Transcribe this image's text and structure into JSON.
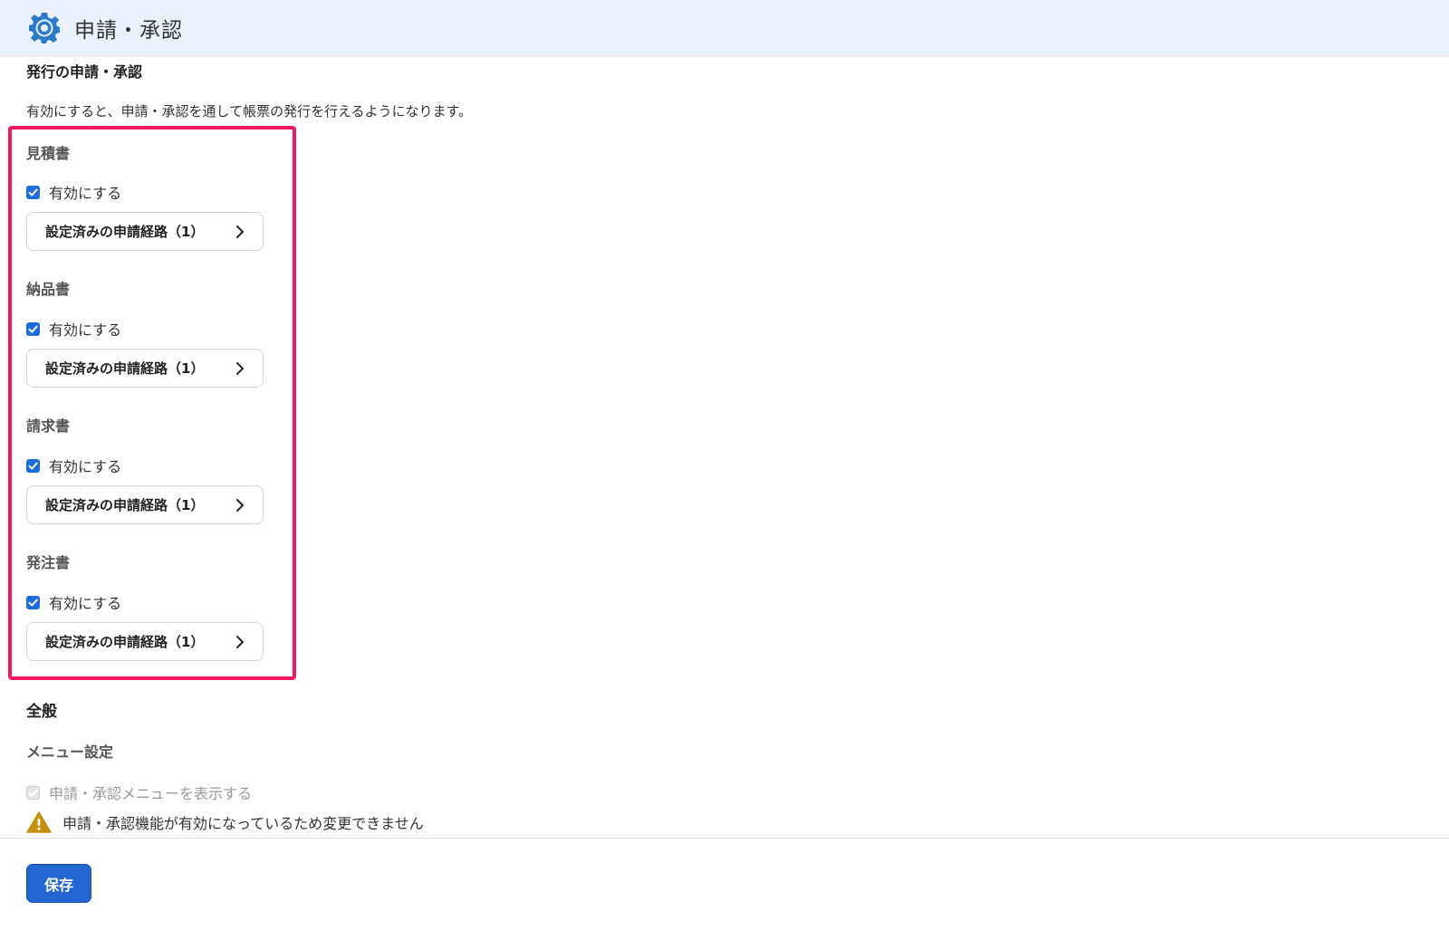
{
  "header": {
    "title": "申請・承認",
    "icon": "gear-icon"
  },
  "issuance": {
    "title": "発行の申請・承認",
    "description": "有効にすると、申請・承認を通して帳票の発行を行えるようになります。",
    "documents": [
      {
        "label": "見積書",
        "checkbox_label": "有効にする",
        "checked": true,
        "route_button": "設定済みの申請経路（1）"
      },
      {
        "label": "納品書",
        "checkbox_label": "有効にする",
        "checked": true,
        "route_button": "設定済みの申請経路（1）"
      },
      {
        "label": "請求書",
        "checkbox_label": "有効にする",
        "checked": true,
        "route_button": "設定済みの申請経路（1）"
      },
      {
        "label": "発注書",
        "checkbox_label": "有効にする",
        "checked": true,
        "route_button": "設定済みの申請経路（1）"
      }
    ]
  },
  "general": {
    "title": "全般",
    "menu_settings_title": "メニュー設定",
    "menu_checkbox_label": "申請・承認メニューを表示する",
    "menu_checkbox_checked": true,
    "menu_checkbox_disabled": true,
    "warning": "申請・承認機能が有効になっているため変更できません"
  },
  "footer": {
    "save_label": "保存"
  },
  "colors": {
    "accent": "#2366d1",
    "highlight": "#f0185e",
    "header_bg": "#e9f1fc",
    "warning": "#c8900c"
  }
}
